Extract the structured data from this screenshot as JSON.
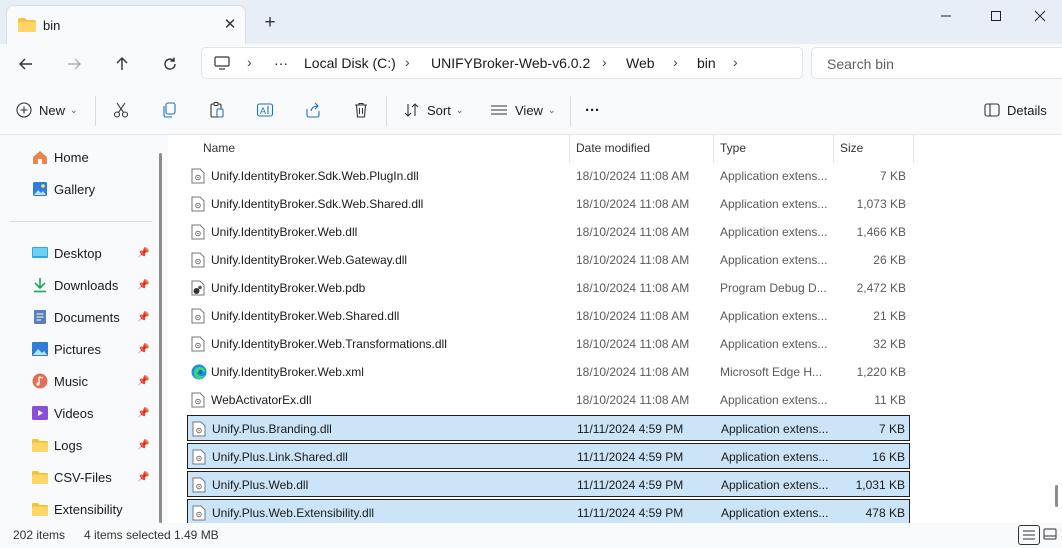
{
  "window": {
    "tab_title": "bin",
    "new_tab_symbol": "+",
    "close_tab_symbol": "✕"
  },
  "address": {
    "overflow": "···",
    "crumbs": [
      "Local Disk (C:)",
      "UNIFYBroker-Web-v6.0.2",
      "Web",
      "bin"
    ]
  },
  "search": {
    "placeholder": "Search bin"
  },
  "toolbar": {
    "new_label": "New",
    "sort_label": "Sort",
    "view_label": "View",
    "more_label": "···",
    "details_label": "Details"
  },
  "sidebar": {
    "top_items": [
      {
        "label": "Home",
        "icon": "home-icon"
      },
      {
        "label": "Gallery",
        "icon": "gallery-icon"
      }
    ],
    "pinned_items": [
      {
        "label": "Desktop",
        "icon": "desktop-icon"
      },
      {
        "label": "Downloads",
        "icon": "downloads-icon"
      },
      {
        "label": "Documents",
        "icon": "documents-icon"
      },
      {
        "label": "Pictures",
        "icon": "pictures-icon"
      },
      {
        "label": "Music",
        "icon": "music-icon"
      },
      {
        "label": "Videos",
        "icon": "videos-icon"
      },
      {
        "label": "Logs",
        "icon": "folder-icon"
      },
      {
        "label": "CSV-Files",
        "icon": "folder-icon"
      },
      {
        "label": "Extensibility",
        "icon": "folder-icon"
      }
    ]
  },
  "columns": {
    "name": "Name",
    "date": "Date modified",
    "type": "Type",
    "size": "Size"
  },
  "files": [
    {
      "name": "Unify.IdentityBroker.Sdk.Web.PlugIn.dll",
      "date": "18/10/2024 11:08 AM",
      "type": "Application extens...",
      "size": "7 KB",
      "icon": "dll-file-icon",
      "selected": false
    },
    {
      "name": "Unify.IdentityBroker.Sdk.Web.Shared.dll",
      "date": "18/10/2024 11:08 AM",
      "type": "Application extens...",
      "size": "1,073 KB",
      "icon": "dll-file-icon",
      "selected": false
    },
    {
      "name": "Unify.IdentityBroker.Web.dll",
      "date": "18/10/2024 11:08 AM",
      "type": "Application extens...",
      "size": "1,466 KB",
      "icon": "dll-file-icon",
      "selected": false
    },
    {
      "name": "Unify.IdentityBroker.Web.Gateway.dll",
      "date": "18/10/2024 11:08 AM",
      "type": "Application extens...",
      "size": "26 KB",
      "icon": "dll-file-icon",
      "selected": false
    },
    {
      "name": "Unify.IdentityBroker.Web.pdb",
      "date": "18/10/2024 11:08 AM",
      "type": "Program Debug D...",
      "size": "2,472 KB",
      "icon": "pdb-file-icon",
      "selected": false
    },
    {
      "name": "Unify.IdentityBroker.Web.Shared.dll",
      "date": "18/10/2024 11:08 AM",
      "type": "Application extens...",
      "size": "21 KB",
      "icon": "dll-file-icon",
      "selected": false
    },
    {
      "name": "Unify.IdentityBroker.Web.Transformations.dll",
      "date": "18/10/2024 11:08 AM",
      "type": "Application extens...",
      "size": "32 KB",
      "icon": "dll-file-icon",
      "selected": false
    },
    {
      "name": "Unify.IdentityBroker.Web.xml",
      "date": "18/10/2024 11:08 AM",
      "type": "Microsoft Edge H...",
      "size": "1,220 KB",
      "icon": "edge-file-icon",
      "selected": false
    },
    {
      "name": "WebActivatorEx.dll",
      "date": "18/10/2024 11:08 AM",
      "type": "Application extens...",
      "size": "11 KB",
      "icon": "dll-file-icon",
      "selected": false
    },
    {
      "name": "Unify.Plus.Branding.dll",
      "date": "11/11/2024 4:59 PM",
      "type": "Application extens...",
      "size": "7 KB",
      "icon": "dll-file-icon",
      "selected": true
    },
    {
      "name": "Unify.Plus.Link.Shared.dll",
      "date": "11/11/2024 4:59 PM",
      "type": "Application extens...",
      "size": "16 KB",
      "icon": "dll-file-icon",
      "selected": true
    },
    {
      "name": "Unify.Plus.Web.dll",
      "date": "11/11/2024 4:59 PM",
      "type": "Application extens...",
      "size": "1,031 KB",
      "icon": "dll-file-icon",
      "selected": true
    },
    {
      "name": "Unify.Plus.Web.Extensibility.dll",
      "date": "11/11/2024 4:59 PM",
      "type": "Application extens...",
      "size": "478 KB",
      "icon": "dll-file-icon",
      "selected": true
    }
  ],
  "status": {
    "item_count": "202 items",
    "selection": "4 items selected",
    "selection_size": "1.49 MB"
  },
  "colors": {
    "selected_row": "#cce4f7",
    "folder_yellow": "#f5c342",
    "accent_blue": "#1e6fc8"
  }
}
